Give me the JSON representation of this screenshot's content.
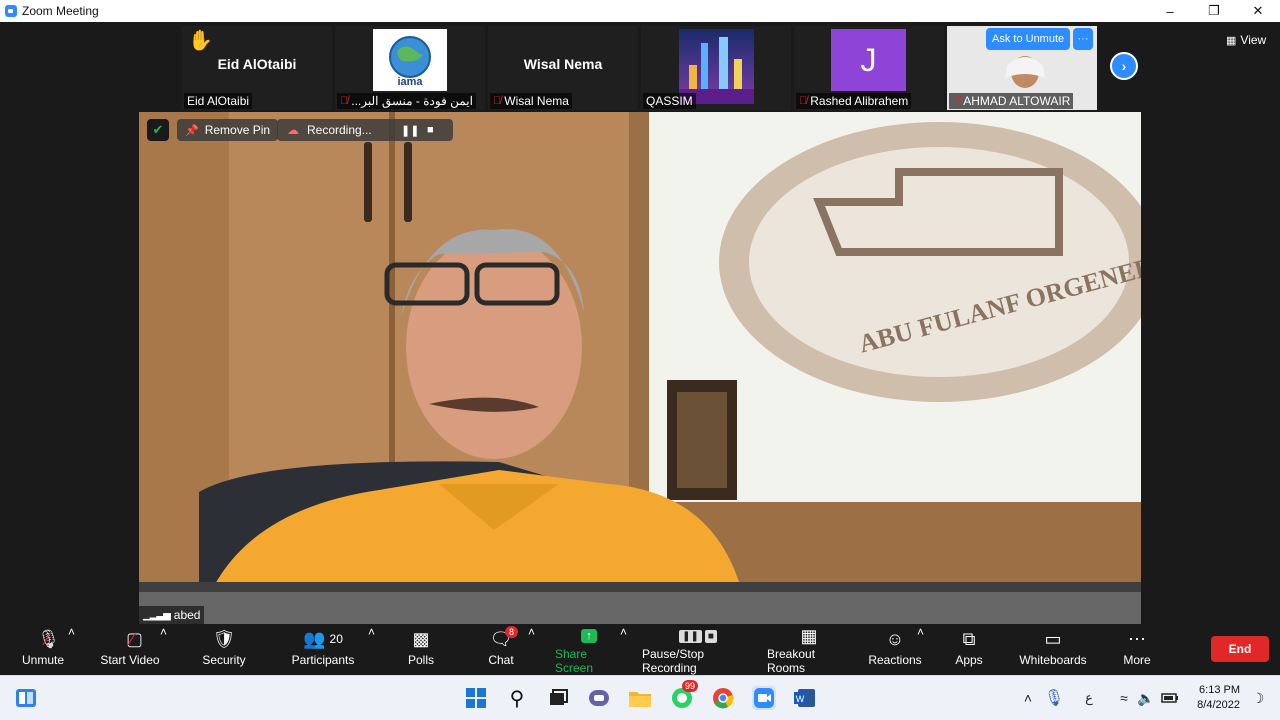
{
  "window": {
    "title": "Zoom Meeting"
  },
  "gallery": {
    "tiles": [
      {
        "name": "Eid AlOtaibi",
        "label": "Eid AlOtaibi"
      },
      {
        "logo_text": "iama",
        "label": "...ايمن فودة - منسق البر"
      },
      {
        "name": "Wisal Nema",
        "label": "Wisal Nema"
      },
      {
        "label": "QASSIM"
      },
      {
        "initial": "J",
        "label": "Rashed Alibrahem"
      },
      {
        "label": "AHMAD ALTOWAIR",
        "ask_label": "Ask to Unmute",
        "more_label": "···"
      }
    ],
    "view_label": "View"
  },
  "main_video": {
    "remove_pin_label": "Remove Pin",
    "recording_label": "Recording...",
    "speaker_name": "abed",
    "crest_text": "ABU FULANF ORGENERAL"
  },
  "toolbar": {
    "unmute": "Unmute",
    "start_video": "Start Video",
    "security": "Security",
    "participants": "Participants",
    "participants_count": "20",
    "polls": "Polls",
    "chat": "Chat",
    "chat_badge": "8",
    "share_screen": "Share Screen",
    "pause_stop_recording": "Pause/Stop Recording",
    "breakout_rooms": "Breakout Rooms",
    "reactions": "Reactions",
    "apps": "Apps",
    "whiteboards": "Whiteboards",
    "more": "More",
    "end": "End"
  },
  "taskbar": {
    "whatsapp_badge": "99",
    "lang": "ع",
    "time": "6:13 PM",
    "date": "8/4/2022"
  },
  "colors": {
    "accent": "#2d8cff",
    "end": "#e02828",
    "share": "#1db954"
  }
}
